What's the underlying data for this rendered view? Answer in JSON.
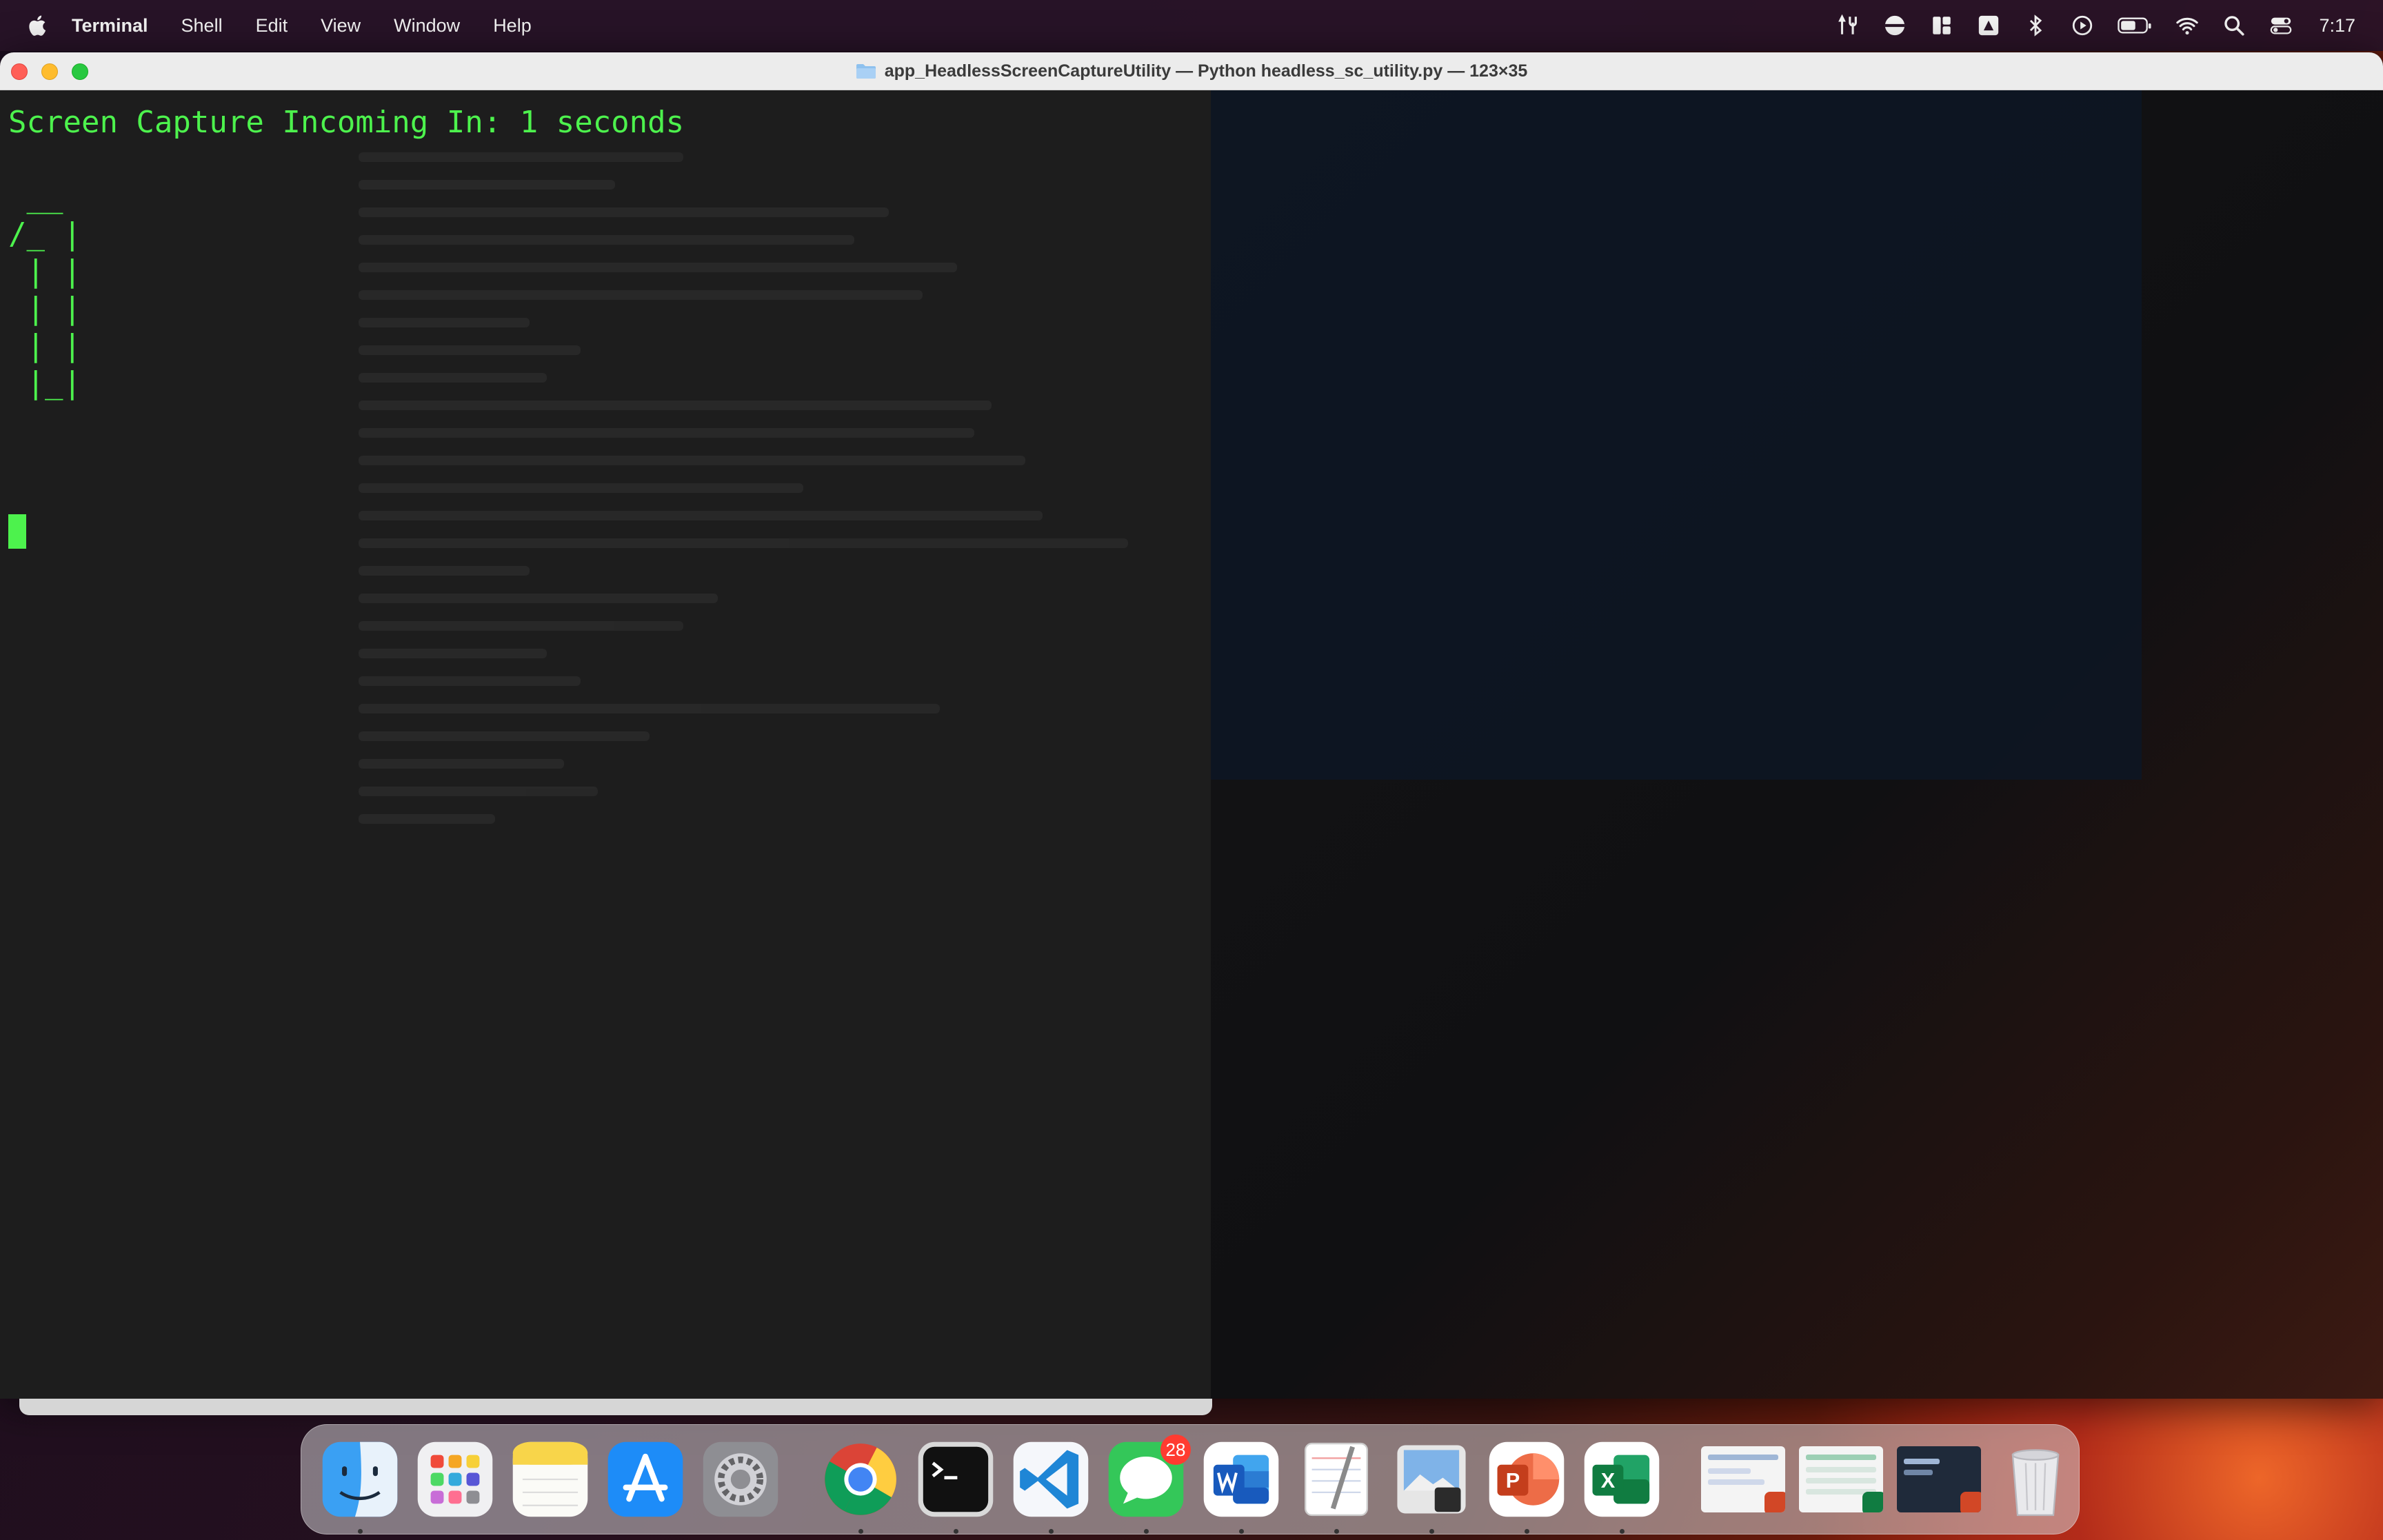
{
  "menubar": {
    "app_name": "Terminal",
    "items": [
      "Shell",
      "Edit",
      "View",
      "Window",
      "Help"
    ],
    "clock": "7:17"
  },
  "window": {
    "title": "app_HeadlessScreenCaptureUtility — Python headless_sc_utility.py — 123×35"
  },
  "terminal": {
    "text_color": "#4df24d",
    "lines": [
      "Screen Capture Incoming In: 1 seconds",
      "",
      " __",
      "/_ |",
      " | |",
      " | |",
      " | |",
      " |_|"
    ]
  },
  "dock": {
    "apps": [
      {
        "name": "Finder",
        "running": true
      },
      {
        "name": "Launchpad",
        "running": false
      },
      {
        "name": "Notes",
        "running": false
      },
      {
        "name": "App Store",
        "running": false
      },
      {
        "name": "System Settings",
        "running": false
      },
      {
        "name": "Google Chrome",
        "running": true
      },
      {
        "name": "Terminal",
        "running": true
      },
      {
        "name": "Visual Studio Code",
        "running": true
      },
      {
        "name": "Messages",
        "running": true,
        "badge": "28"
      },
      {
        "name": "Microsoft Word",
        "running": true
      },
      {
        "name": "TextEdit",
        "running": true
      },
      {
        "name": "Preview",
        "running": true
      },
      {
        "name": "Microsoft PowerPoint",
        "running": true
      },
      {
        "name": "Microsoft Excel",
        "running": true
      }
    ],
    "minimized": [
      "PowerPoint document",
      "Excel document",
      "PowerPoint presentation"
    ],
    "trash": "Trash"
  }
}
